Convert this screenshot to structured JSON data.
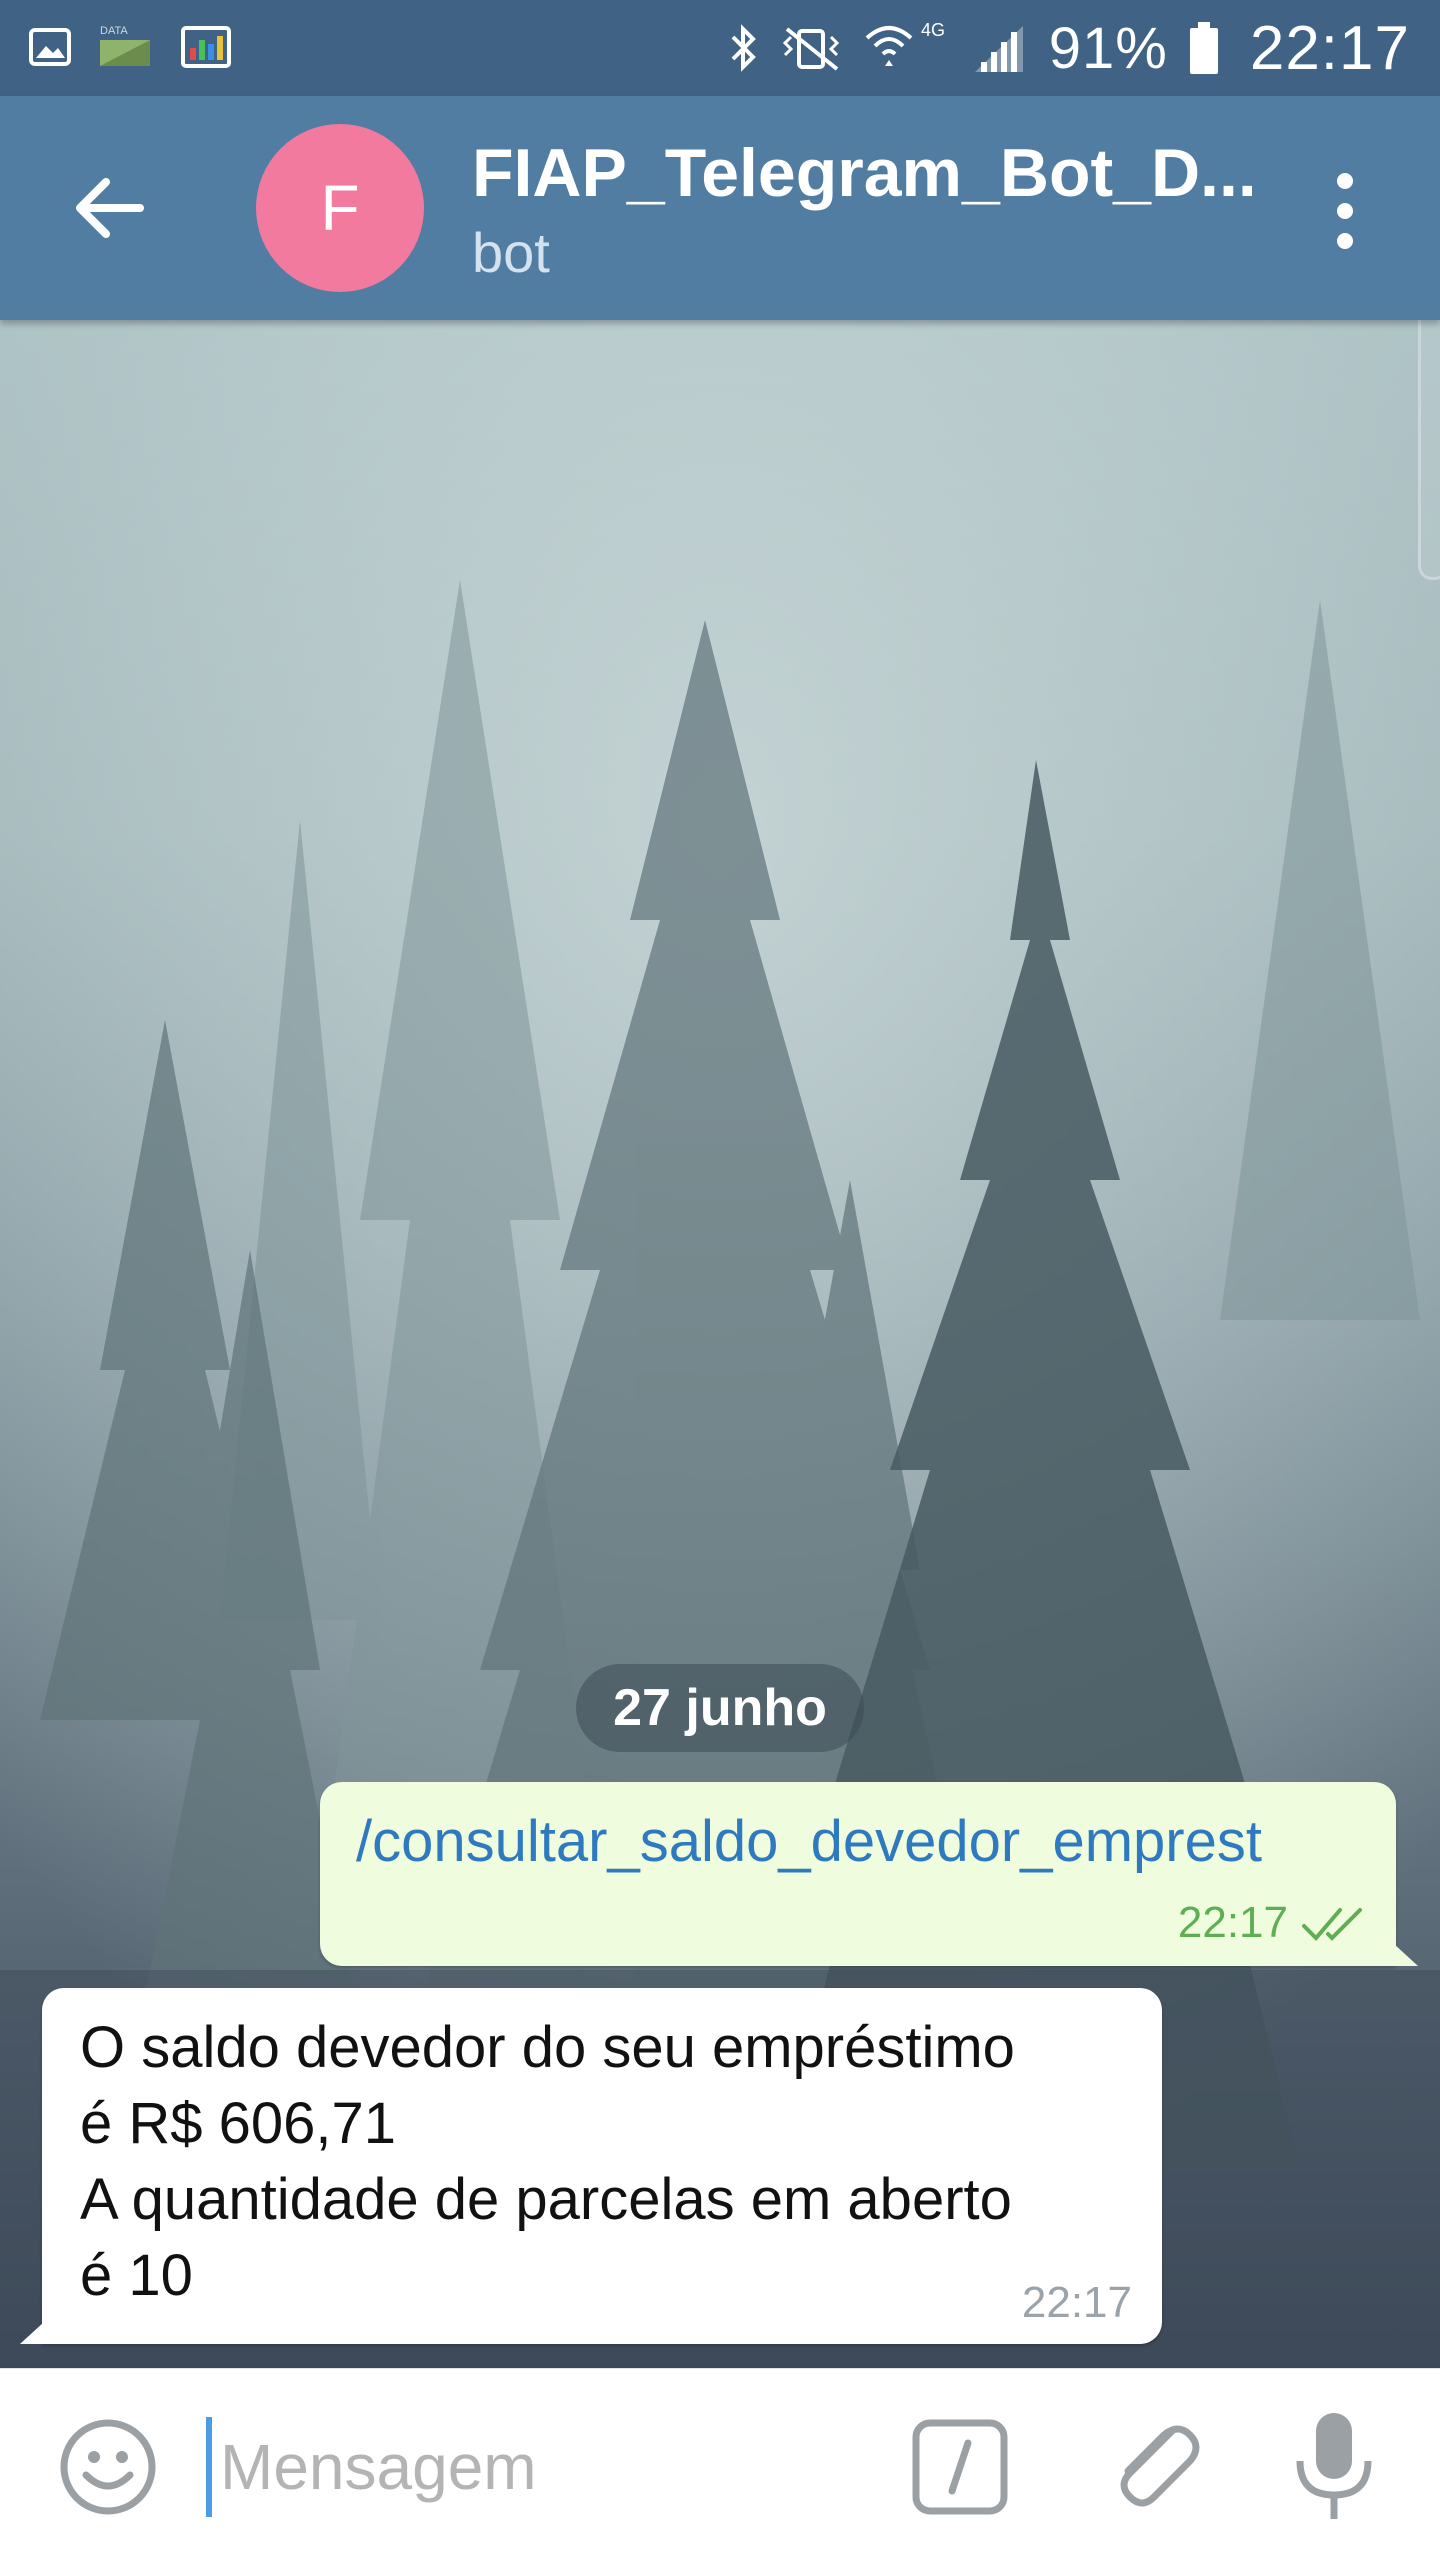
{
  "status_bar": {
    "battery_percent": "91%",
    "time": "22:17",
    "network_label": "4G",
    "data_label": "DATA",
    "icons": [
      "gallery-icon",
      "data-icon",
      "chart-app-icon",
      "bluetooth-icon",
      "vibrate-icon",
      "wifi-icon",
      "signal-icon",
      "battery-icon"
    ]
  },
  "header": {
    "avatar_letter": "F",
    "title": "FIAP_Telegram_Bot_D...",
    "subtitle": "bot",
    "avatar_color": "#f27a9e",
    "bar_color": "#527da3"
  },
  "chat": {
    "date_label": "27 junho",
    "messages": [
      {
        "direction": "outgoing",
        "text": "/consultar_saldo_devedor_emprest",
        "time": "22:17",
        "read": true
      },
      {
        "direction": "incoming",
        "lines": [
          "O saldo devedor do seu empréstimo",
          "é R$ 606,71",
          "A quantidade de parcelas em aberto",
          "é 10"
        ],
        "time": "22:17"
      }
    ]
  },
  "composer": {
    "placeholder": "Mensagem",
    "value": ""
  }
}
